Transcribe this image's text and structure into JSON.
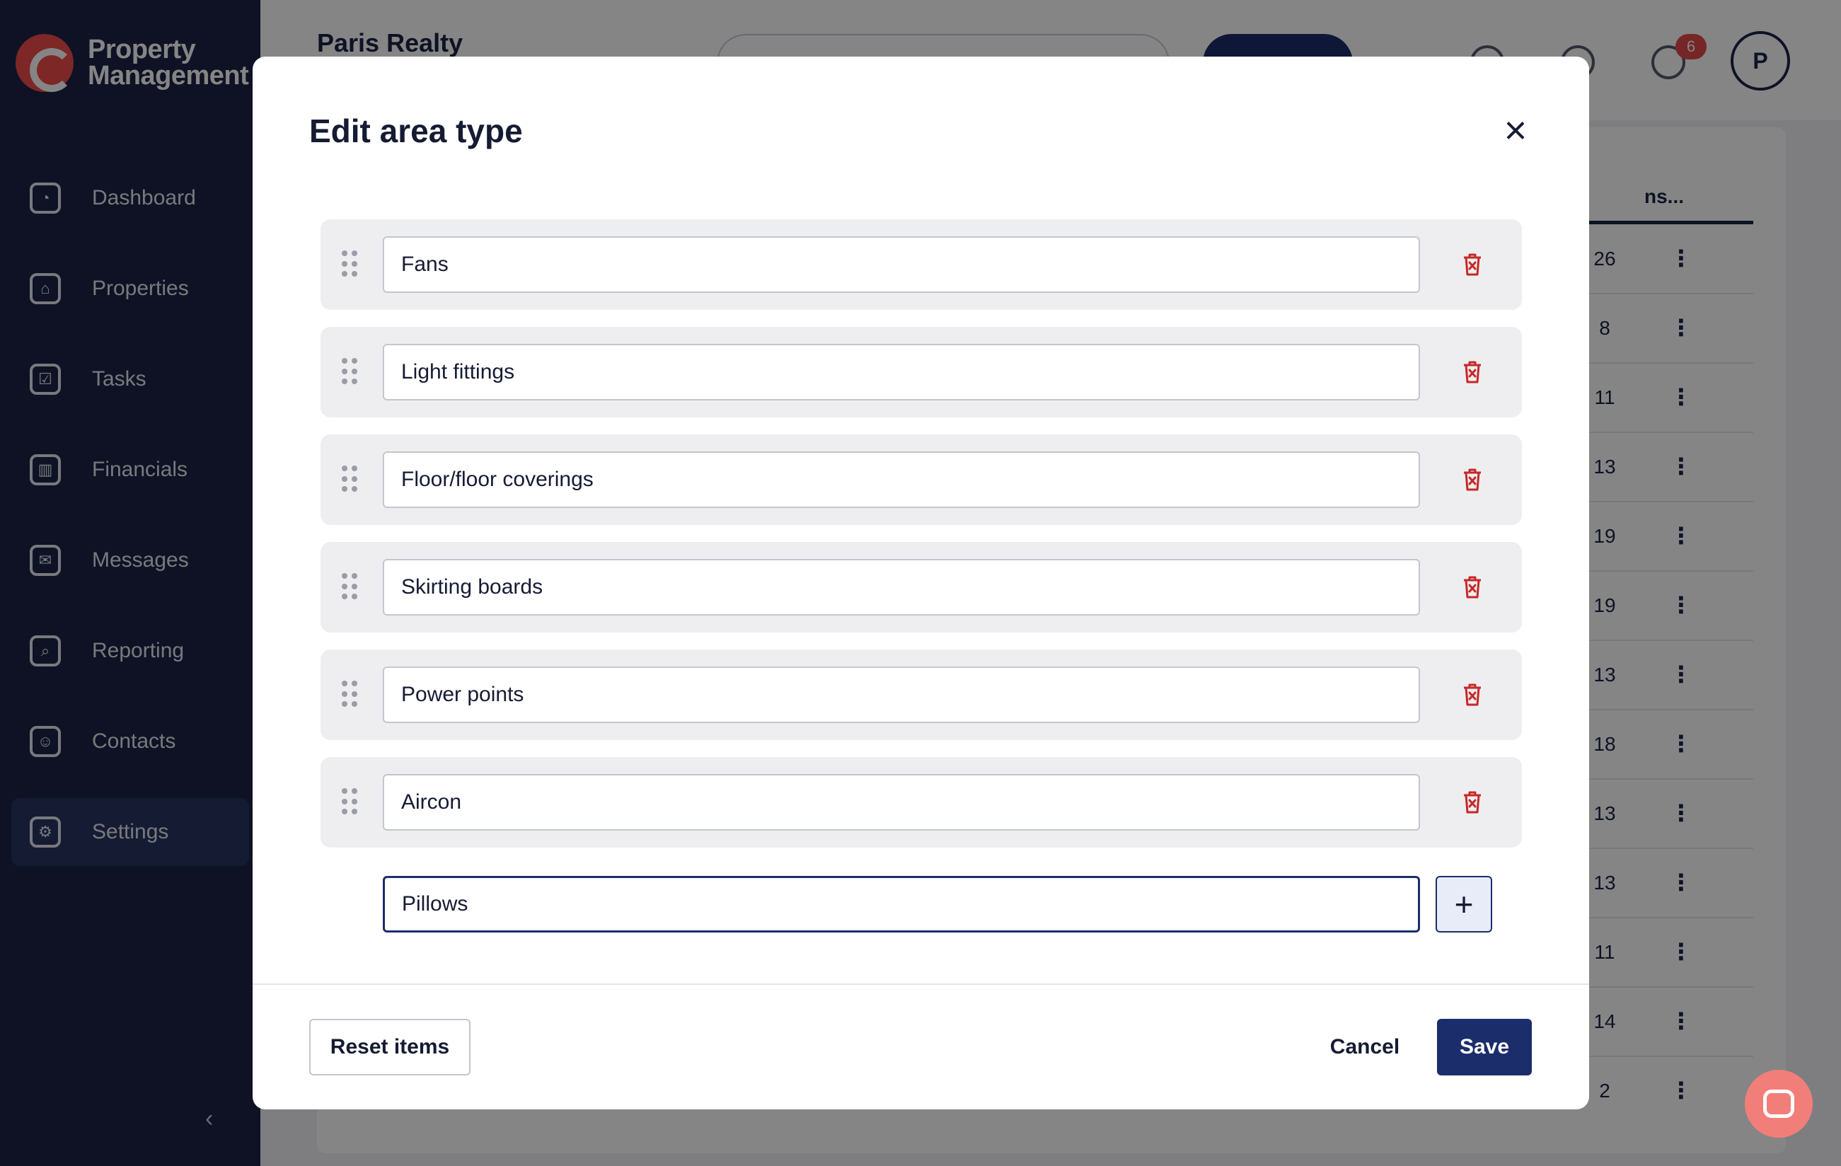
{
  "app": {
    "logo_line1": "Property",
    "logo_line2": "Management",
    "org_name": "Paris Realty",
    "notification_count": "6",
    "avatar_initial": "P"
  },
  "sidebar": {
    "items": [
      {
        "label": "Dashboard",
        "icon": "gauge-icon"
      },
      {
        "label": "Properties",
        "icon": "house-icon"
      },
      {
        "label": "Tasks",
        "icon": "clipboard-icon"
      },
      {
        "label": "Financials",
        "icon": "bank-icon"
      },
      {
        "label": "Messages",
        "icon": "envelope-icon"
      },
      {
        "label": "Reporting",
        "icon": "report-search-icon"
      },
      {
        "label": "Contacts",
        "icon": "people-icon"
      },
      {
        "label": "Settings",
        "icon": "sliders-icon"
      }
    ],
    "active": "Settings"
  },
  "background_table": {
    "column_header": "ns...",
    "counts": [
      "26",
      "8",
      "11",
      "13",
      "19",
      "19",
      "13",
      "18",
      "13",
      "13",
      "11",
      "14",
      "2"
    ]
  },
  "modal": {
    "title": "Edit area type",
    "items": [
      "Fans",
      "Light fittings",
      "Floor/floor coverings",
      "Skirting boards",
      "Power points",
      "Aircon"
    ],
    "new_item_value": "Pillows",
    "add_label": "+",
    "reset_label": "Reset items",
    "cancel_label": "Cancel",
    "save_label": "Save"
  },
  "colors": {
    "sidebar_bg": "#1b2345",
    "primary": "#1b2d6b",
    "danger": "#c62828",
    "row_bg": "#eeeef0",
    "chat_accent": "#f27e7a"
  }
}
